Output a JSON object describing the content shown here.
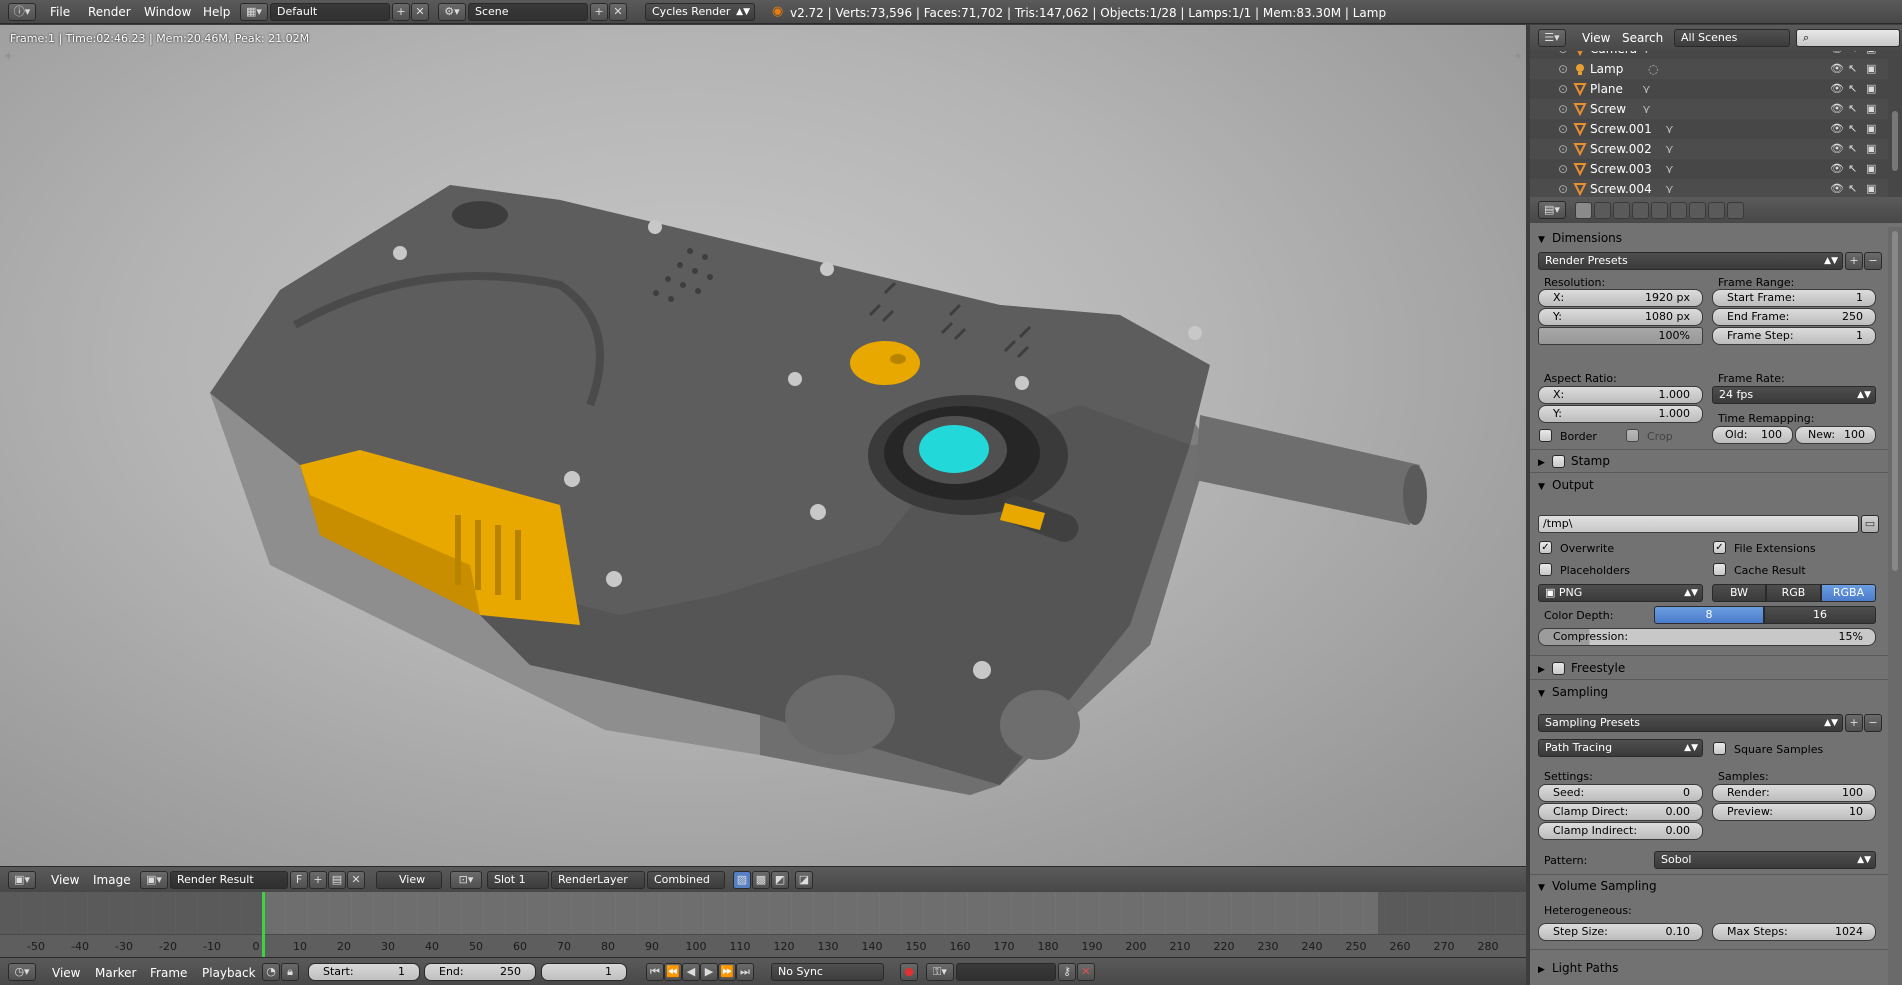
{
  "topbar": {
    "menus": [
      "File",
      "Render",
      "Window",
      "Help"
    ],
    "layout": "Default",
    "scene": "Scene",
    "engine": "Cycles Render",
    "stats": "v2.72 | Verts:73,596 | Faces:71,702 | Tris:147,062 | Objects:1/28 | Lamps:1/1 | Mem:83.30M | Lamp"
  },
  "viewport": {
    "info": "Frame:1 | Time:02:46.23 | Mem:20.46M, Peak: 21.02M"
  },
  "image_header": {
    "view": "View",
    "image": "Image",
    "render_result": "Render Result",
    "fake_user": "F",
    "view_dd": "View",
    "slot": "Slot 1",
    "layer": "RenderLayer",
    "pass": "Combined"
  },
  "timeline": {
    "ticks": [
      "-50",
      "-40",
      "-30",
      "-20",
      "-10",
      "0",
      "10",
      "20",
      "30",
      "40",
      "50",
      "60",
      "70",
      "80",
      "90",
      "100",
      "110",
      "120",
      "130",
      "140",
      "150",
      "160",
      "170",
      "180",
      "190",
      "200",
      "210",
      "220",
      "230",
      "240",
      "250",
      "260",
      "270",
      "280"
    ],
    "menus": [
      "View",
      "Marker",
      "Frame",
      "Playback"
    ],
    "start_label": "Start:",
    "start": "1",
    "end_label": "End:",
    "end": "250",
    "current": "1",
    "sync": "No Sync"
  },
  "outliner": {
    "view": "View",
    "search": "Search",
    "scenes": "All Scenes",
    "rows": [
      "Camera",
      "Lamp",
      "Plane",
      "Screw",
      "Screw.001",
      "Screw.002",
      "Screw.003",
      "Screw.004"
    ]
  },
  "dimensions": {
    "title": "Dimensions",
    "presets": "Render Presets",
    "resolution_label": "Resolution:",
    "res_x_label": "X:",
    "res_x": "1920 px",
    "res_y_label": "Y:",
    "res_y": "1080 px",
    "res_pct": "100%",
    "frame_range_label": "Frame Range:",
    "start_label": "Start Frame:",
    "start": "1",
    "end_label": "End Frame:",
    "end": "250",
    "step_label": "Frame Step:",
    "step": "1",
    "aspect_label": "Aspect Ratio:",
    "asp_x_label": "X:",
    "asp_x": "1.000",
    "asp_y_label": "Y:",
    "asp_y": "1.000",
    "frame_rate_label": "Frame Rate:",
    "fps": "24 fps",
    "remap_label": "Time Remapping:",
    "old_label": "Old:",
    "old": "100",
    "new_label": "New:",
    "new": "100",
    "border": "Border",
    "crop": "Crop"
  },
  "stamp": {
    "title": "Stamp"
  },
  "output": {
    "title": "Output",
    "path": "/tmp\\",
    "overwrite": "Overwrite",
    "file_ext": "File Extensions",
    "placeholders": "Placeholders",
    "cache": "Cache Result",
    "format": "PNG",
    "bw": "BW",
    "rgb": "RGB",
    "rgba": "RGBA",
    "color_depth_label": "Color Depth:",
    "depth8": "8",
    "depth16": "16",
    "compression_label": "Compression:",
    "compression": "15%"
  },
  "freestyle": {
    "title": "Freestyle"
  },
  "sampling": {
    "title": "Sampling",
    "presets": "Sampling Presets",
    "integrator": "Path Tracing",
    "square": "Square Samples",
    "settings_label": "Settings:",
    "samples_label": "Samples:",
    "seed_label": "Seed:",
    "seed": "0",
    "clamp_direct_label": "Clamp Direct:",
    "clamp_direct": "0.00",
    "clamp_indirect_label": "Clamp Indirect:",
    "clamp_indirect": "0.00",
    "render_label": "Render:",
    "render": "100",
    "preview_label": "Preview:",
    "preview": "10",
    "pattern_label": "Pattern:",
    "pattern": "Sobol"
  },
  "volume": {
    "title": "Volume Sampling",
    "hetero_label": "Heterogeneous:",
    "step_label": "Step Size:",
    "step": "0.10",
    "max_label": "Max Steps:",
    "max": "1024"
  },
  "light_paths": {
    "title": "Light Paths"
  },
  "colors": {
    "accent_blue": "#5680c2",
    "object_yellow": "#e8a800",
    "button_cyan": "#22d8d8",
    "playhead_green": "#3fd13f"
  }
}
